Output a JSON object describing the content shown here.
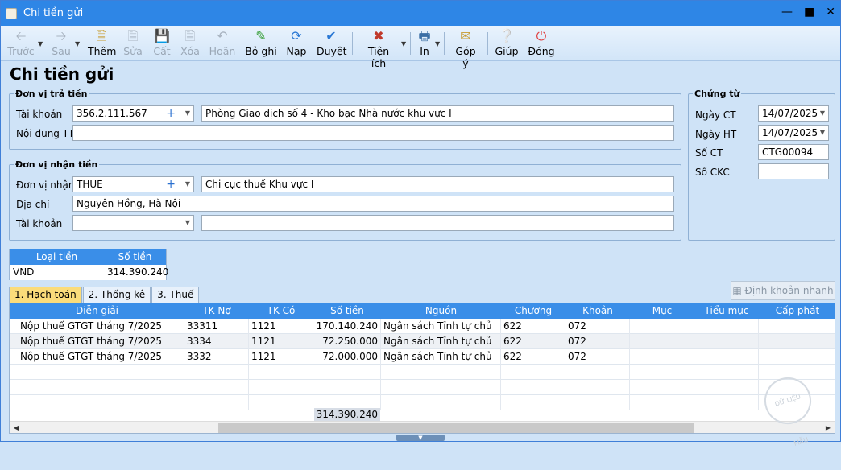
{
  "window": {
    "title": "Chi tiền gửi"
  },
  "toolbar": {
    "items": [
      {
        "label": "Trước",
        "icon": "arrow-left-icon"
      },
      {
        "label": "Sau",
        "icon": "arrow-right-icon"
      },
      {
        "label": "Thêm",
        "icon": "new-document-icon"
      },
      {
        "label": "Sửa",
        "icon": "edit-document-icon"
      },
      {
        "label": "Cất",
        "icon": "save-icon"
      },
      {
        "label": "Xóa",
        "icon": "delete-document-icon"
      },
      {
        "label": "Hoãn",
        "icon": "undo-icon"
      },
      {
        "label": "Bỏ ghi",
        "icon": "unpost-icon"
      },
      {
        "label": "Nạp",
        "icon": "refresh-icon"
      },
      {
        "label": "Duyệt",
        "icon": "check-icon"
      },
      {
        "label": "Tiện ích",
        "icon": "tools-icon"
      },
      {
        "label": "In",
        "icon": "printer-icon"
      },
      {
        "label": "Góp ý",
        "icon": "feedback-icon"
      },
      {
        "label": "Giúp",
        "icon": "help-icon"
      },
      {
        "label": "Đóng",
        "icon": "power-icon"
      }
    ]
  },
  "page": {
    "title": "Chi tiền gửi"
  },
  "payer": {
    "legend": "Đơn vị trả tiền",
    "account_label": "Tài khoản",
    "account_value": "356.2.111.567",
    "account_name": "Phòng Giao dịch số 4 - Kho bạc Nhà nước khu vực I",
    "content_label": "Nội dung TT",
    "content_value": ""
  },
  "payee": {
    "legend": "Đơn vị nhận tiền",
    "unit_label": "Đơn vị nhận",
    "unit_value": "THUE",
    "unit_name": "Chi cục thuế Khu vực I",
    "address_label": "Địa chỉ",
    "address_value": "Nguyên Hồng, Hà Nội",
    "account_label": "Tài khoản",
    "account_value": "",
    "account_name": ""
  },
  "voucher": {
    "legend": "Chứng từ",
    "date_ct_label": "Ngày CT",
    "date_ct_value": "14/07/2025",
    "date_ht_label": "Ngày HT",
    "date_ht_value": "14/07/2025",
    "so_ct_label": "Số CT",
    "so_ct_value": "CTG00094",
    "so_ckc_label": "Số CKC",
    "so_ckc_value": ""
  },
  "currency": {
    "headers": [
      "Loại tiền",
      "Số tiền"
    ],
    "currency": "VND",
    "amount": "314.390.240"
  },
  "tabs": [
    {
      "num": "1",
      "label": ". Hạch toán"
    },
    {
      "num": "2",
      "label": ". Thống kê"
    },
    {
      "num": "3",
      "label": ". Thuế"
    }
  ],
  "auto_button": "Định khoản nhanh",
  "grid": {
    "headers": [
      "Diễn giải",
      "TK Nợ",
      "TK Có",
      "Số tiền",
      "Nguồn",
      "Chương",
      "Khoản",
      "Mục",
      "Tiểu mục",
      "Cấp phát"
    ],
    "rows": [
      [
        "Nộp thuế GTGT tháng 7/2025",
        "33311",
        "1121",
        "170.140.240",
        "Ngân sách Tỉnh tự chủ",
        "622",
        "072",
        "",
        "",
        ""
      ],
      [
        "Nộp thuế GTGT tháng 7/2025",
        "3334",
        "1121",
        "72.250.000",
        "Ngân sách Tỉnh tự chủ",
        "622",
        "072",
        "",
        "",
        ""
      ],
      [
        "Nộp thuế GTGT tháng 7/2025",
        "3332",
        "1121",
        "72.000.000",
        "Ngân sách Tỉnh tự chủ",
        "622",
        "072",
        "",
        "",
        ""
      ]
    ],
    "total": "314.390.240"
  },
  "watermark": "DỮ LIỆU MẪU",
  "colors": {
    "titlebar": "#2e86e6",
    "header": "#3a8ee8",
    "active_tab": "#fbdc7a",
    "background": "#cfe3f7"
  }
}
